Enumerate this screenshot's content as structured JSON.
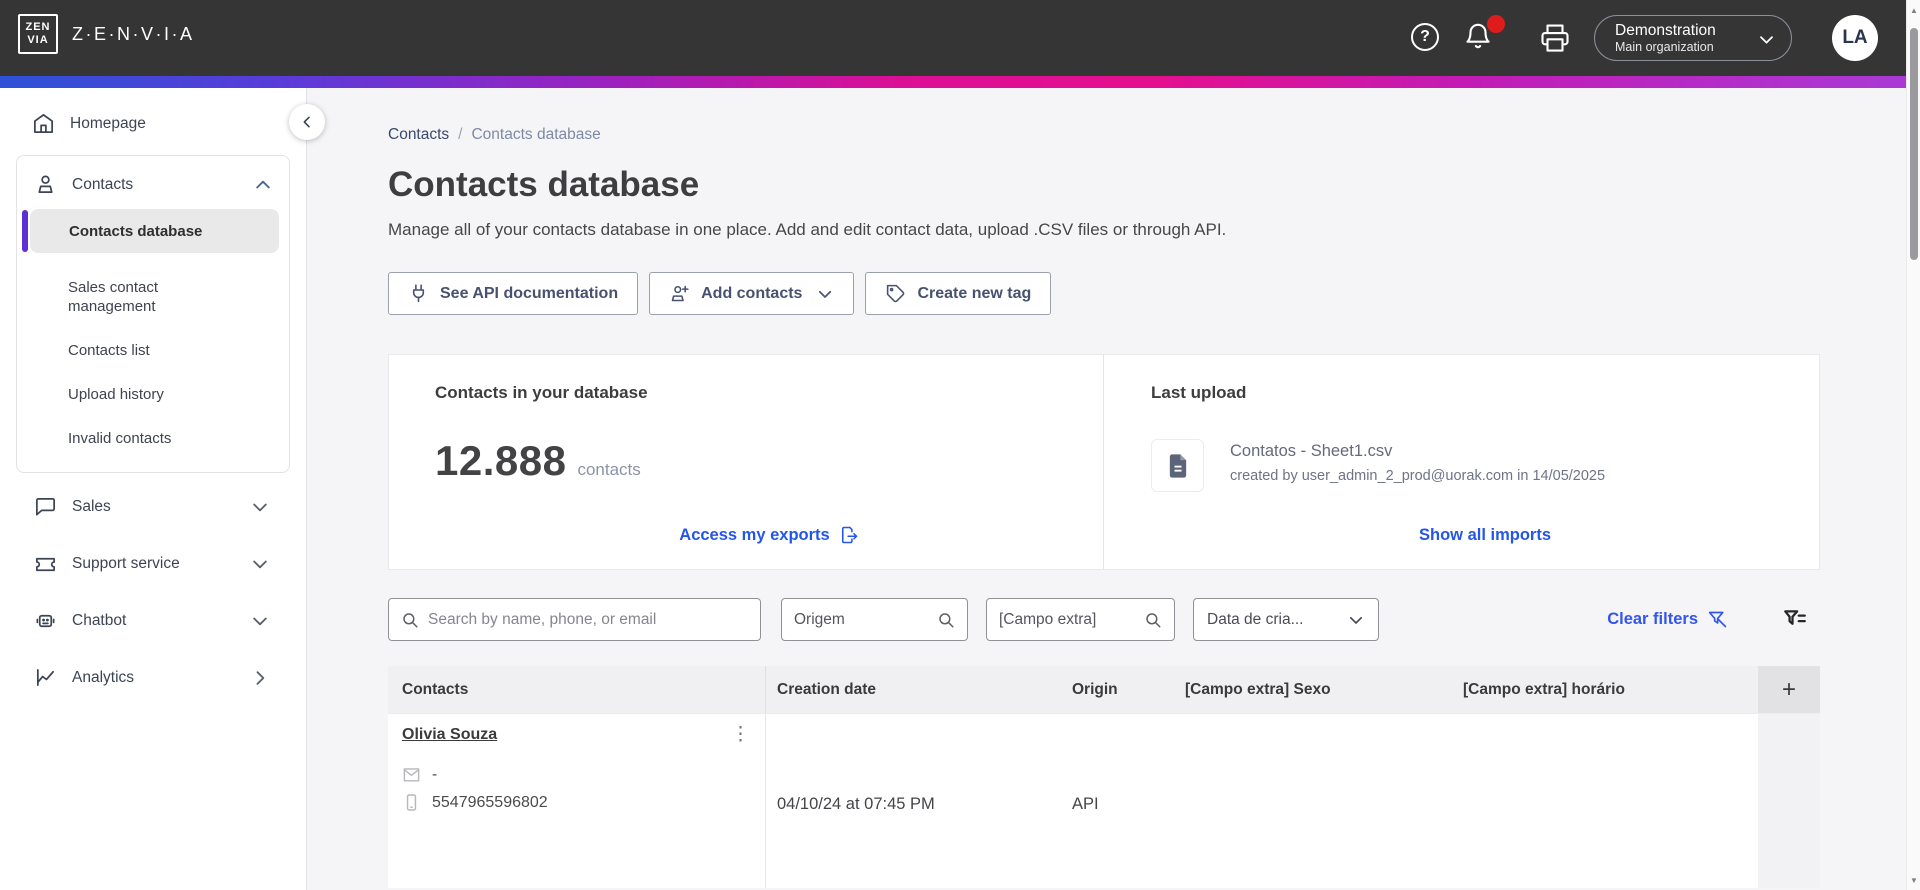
{
  "topbar": {
    "logo_mark_top": "ZEN",
    "logo_mark_bottom": "VIA",
    "brand": "Z·E·N·V·I·A",
    "help_glyph": "?",
    "account_name": "Demonstration",
    "account_org": "Main organization",
    "avatar_initials": "LA"
  },
  "sidebar": {
    "homepage": "Homepage",
    "contacts": {
      "label": "Contacts",
      "items": [
        {
          "label": "Contacts database",
          "active": true
        },
        {
          "label": "Sales contact management"
        },
        {
          "label": "Contacts list"
        },
        {
          "label": "Upload history"
        },
        {
          "label": "Invalid contacts"
        }
      ]
    },
    "sections": [
      {
        "label": "Sales"
      },
      {
        "label": "Support service"
      },
      {
        "label": "Chatbot"
      },
      {
        "label": "Analytics"
      }
    ]
  },
  "breadcrumb": {
    "parent": "Contacts",
    "separator": "/",
    "current": "Contacts database"
  },
  "page": {
    "title": "Contacts database",
    "subtitle": "Manage all of your contacts database in one place. Add and edit contact data, upload .CSV files or through API."
  },
  "actions": {
    "api_docs": "See API documentation",
    "add_contacts": "Add contacts",
    "create_tag": "Create new tag"
  },
  "stats": {
    "heading": "Contacts in your database",
    "count": "12.888",
    "unit": "contacts",
    "exports_link": "Access my exports"
  },
  "last_upload": {
    "heading": "Last upload",
    "filename": "Contatos - Sheet1.csv",
    "created_by": "created by user_admin_2_prod@uorak.com in 14/05/2025",
    "link": "Show all imports"
  },
  "filters": {
    "search_placeholder": "Search by name, phone, or email",
    "origin_placeholder": "Origem",
    "extra_field_placeholder": "[Campo extra]",
    "creation_date_label": "Data de cria...",
    "clear_label": "Clear filters"
  },
  "table": {
    "headers": [
      "Contacts",
      "Creation date",
      "Origin",
      "[Campo extra] Sexo",
      "[Campo extra] horário"
    ],
    "add_column_label": "+",
    "rows": [
      {
        "name": "Olivia Souza",
        "kebab": "⋮",
        "email": "-",
        "phone": "5547965596802",
        "creation_date": "04/10/24 at 07:45 PM",
        "origin": "API",
        "sexo": "",
        "horario": ""
      }
    ]
  },
  "colors": {
    "topbar_bg": "#353535",
    "link_blue": "#2456ea",
    "active_indicator": "#5e2fd1",
    "notification_red": "#de1c1c",
    "gradient_start": "#2d52d5",
    "gradient_mid": "#e50f8e",
    "gradient_end": "#a93ad6"
  }
}
